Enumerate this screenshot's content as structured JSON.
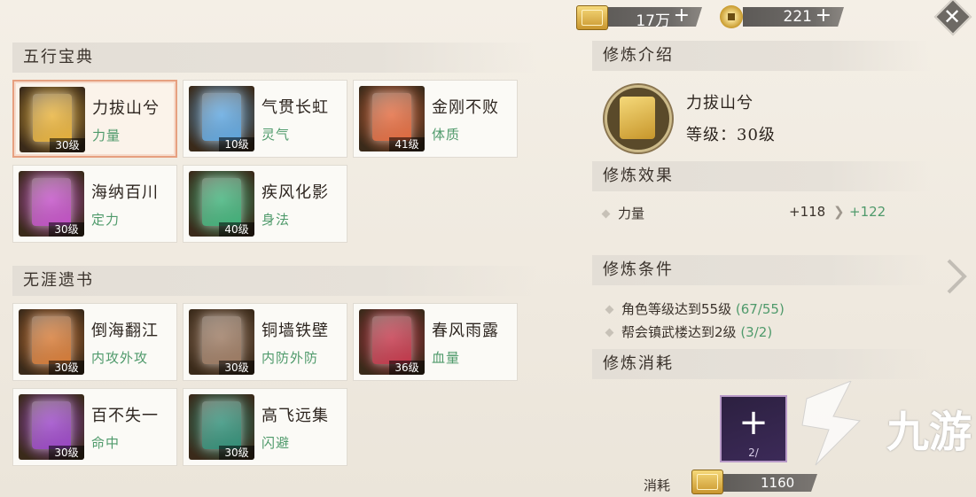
{
  "currency": {
    "gold": {
      "value": "17万",
      "plus": "+",
      "icon": "gold-ingot-icon"
    },
    "coin": {
      "value": "221",
      "plus": "+",
      "icon": "copper-coin-icon"
    }
  },
  "close_label": "✕",
  "sections": {
    "wuxing": "五行宝典",
    "wuya": "无涯遗书"
  },
  "wuxing_cards": [
    {
      "name": "力拔山兮",
      "attr": "力量",
      "level": "30级",
      "color": "#e8b23a"
    },
    {
      "name": "气贯长虹",
      "attr": "灵气",
      "level": "10级",
      "color": "#5ea6e0"
    },
    {
      "name": "金刚不败",
      "attr": "体质",
      "level": "41级",
      "color": "#e36a3e"
    },
    {
      "name": "海纳百川",
      "attr": "定力",
      "level": "30级",
      "color": "#c24fc7"
    },
    {
      "name": "疾风化影",
      "attr": "身法",
      "level": "40级",
      "color": "#3fb27a"
    }
  ],
  "wuya_cards": [
    {
      "name": "倒海翻江",
      "attr": "内攻外攻",
      "level": "30级",
      "color": "#d67a35"
    },
    {
      "name": "铜墙铁壁",
      "attr": "内防外防",
      "level": "30级",
      "color": "#9c7a62"
    },
    {
      "name": "春风雨露",
      "attr": "血量",
      "level": "36级",
      "color": "#c4364a"
    },
    {
      "name": "百不失一",
      "attr": "命中",
      "level": "30级",
      "color": "#9a44c8"
    },
    {
      "name": "高飞远集",
      "attr": "闪避",
      "level": "30级",
      "color": "#2f8f78"
    }
  ],
  "panel": {
    "intro_header": "修炼介绍",
    "skill_name": "力拔山兮",
    "level_label": "等级：30级",
    "effect_header": "修炼效果",
    "effect": {
      "attr": "力量",
      "current": "+118",
      "next": "+122"
    },
    "cond_header": "修炼条件",
    "conditions": [
      {
        "text": "角色等级达到55级",
        "progress": "(67/55)"
      },
      {
        "text": "帮会镇武楼达到2级",
        "progress": "(3/2)"
      }
    ],
    "cost_header": "修炼消耗",
    "slot_plus": "+",
    "slot_count": "2/",
    "cost_label": "消耗",
    "cost_value": "1160"
  },
  "watermark": "九游"
}
